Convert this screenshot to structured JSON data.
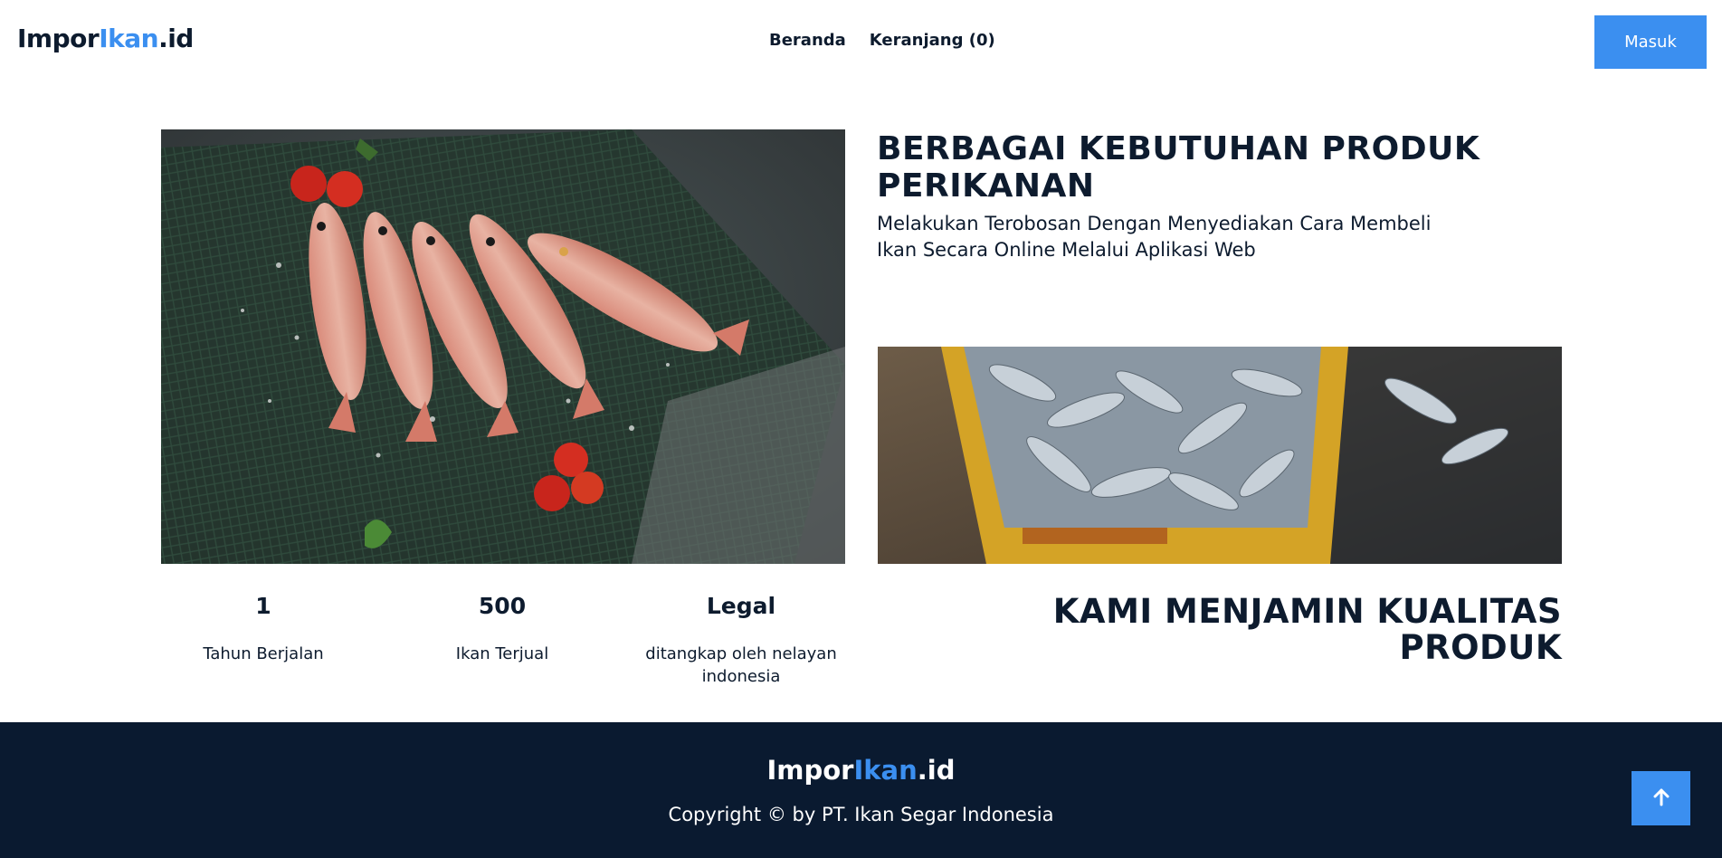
{
  "header": {
    "logo_prefix": "Impor",
    "logo_accent": "Ikan",
    "logo_suffix": ".id",
    "nav": [
      {
        "label": "Beranda"
      },
      {
        "label": "Keranjang (0)"
      }
    ],
    "login_label": "Masuk"
  },
  "hero": {
    "headline_line1": "BERBAGAI KEBUTUHAN PRODUK",
    "headline_line2": "PERIKANAN",
    "subline": "Melakukan Terobosan Dengan Menyediakan Cara Membeli Ikan Secara Online Melalui Aplikasi Web"
  },
  "stats": [
    {
      "value": "1",
      "label": "Tahun Berjalan"
    },
    {
      "value": "500",
      "label": "Ikan Terjual"
    },
    {
      "value": "Legal",
      "label": "ditangkap oleh nelayan indonesia"
    }
  ],
  "quality": {
    "line1": "KAMI MENJAMIN KUALITAS",
    "line2": "PRODUK"
  },
  "footer": {
    "logo_prefix": "Impor",
    "logo_accent": "Ikan",
    "logo_suffix": ".id",
    "copyright": "Copyright © by PT. Ikan Segar Indonesia"
  },
  "icons": {
    "back_to_top": "arrow-up-icon"
  },
  "colors": {
    "accent": "#3b8ff0",
    "navy": "#0d1b2e",
    "footer_bg": "#0a1a30"
  }
}
